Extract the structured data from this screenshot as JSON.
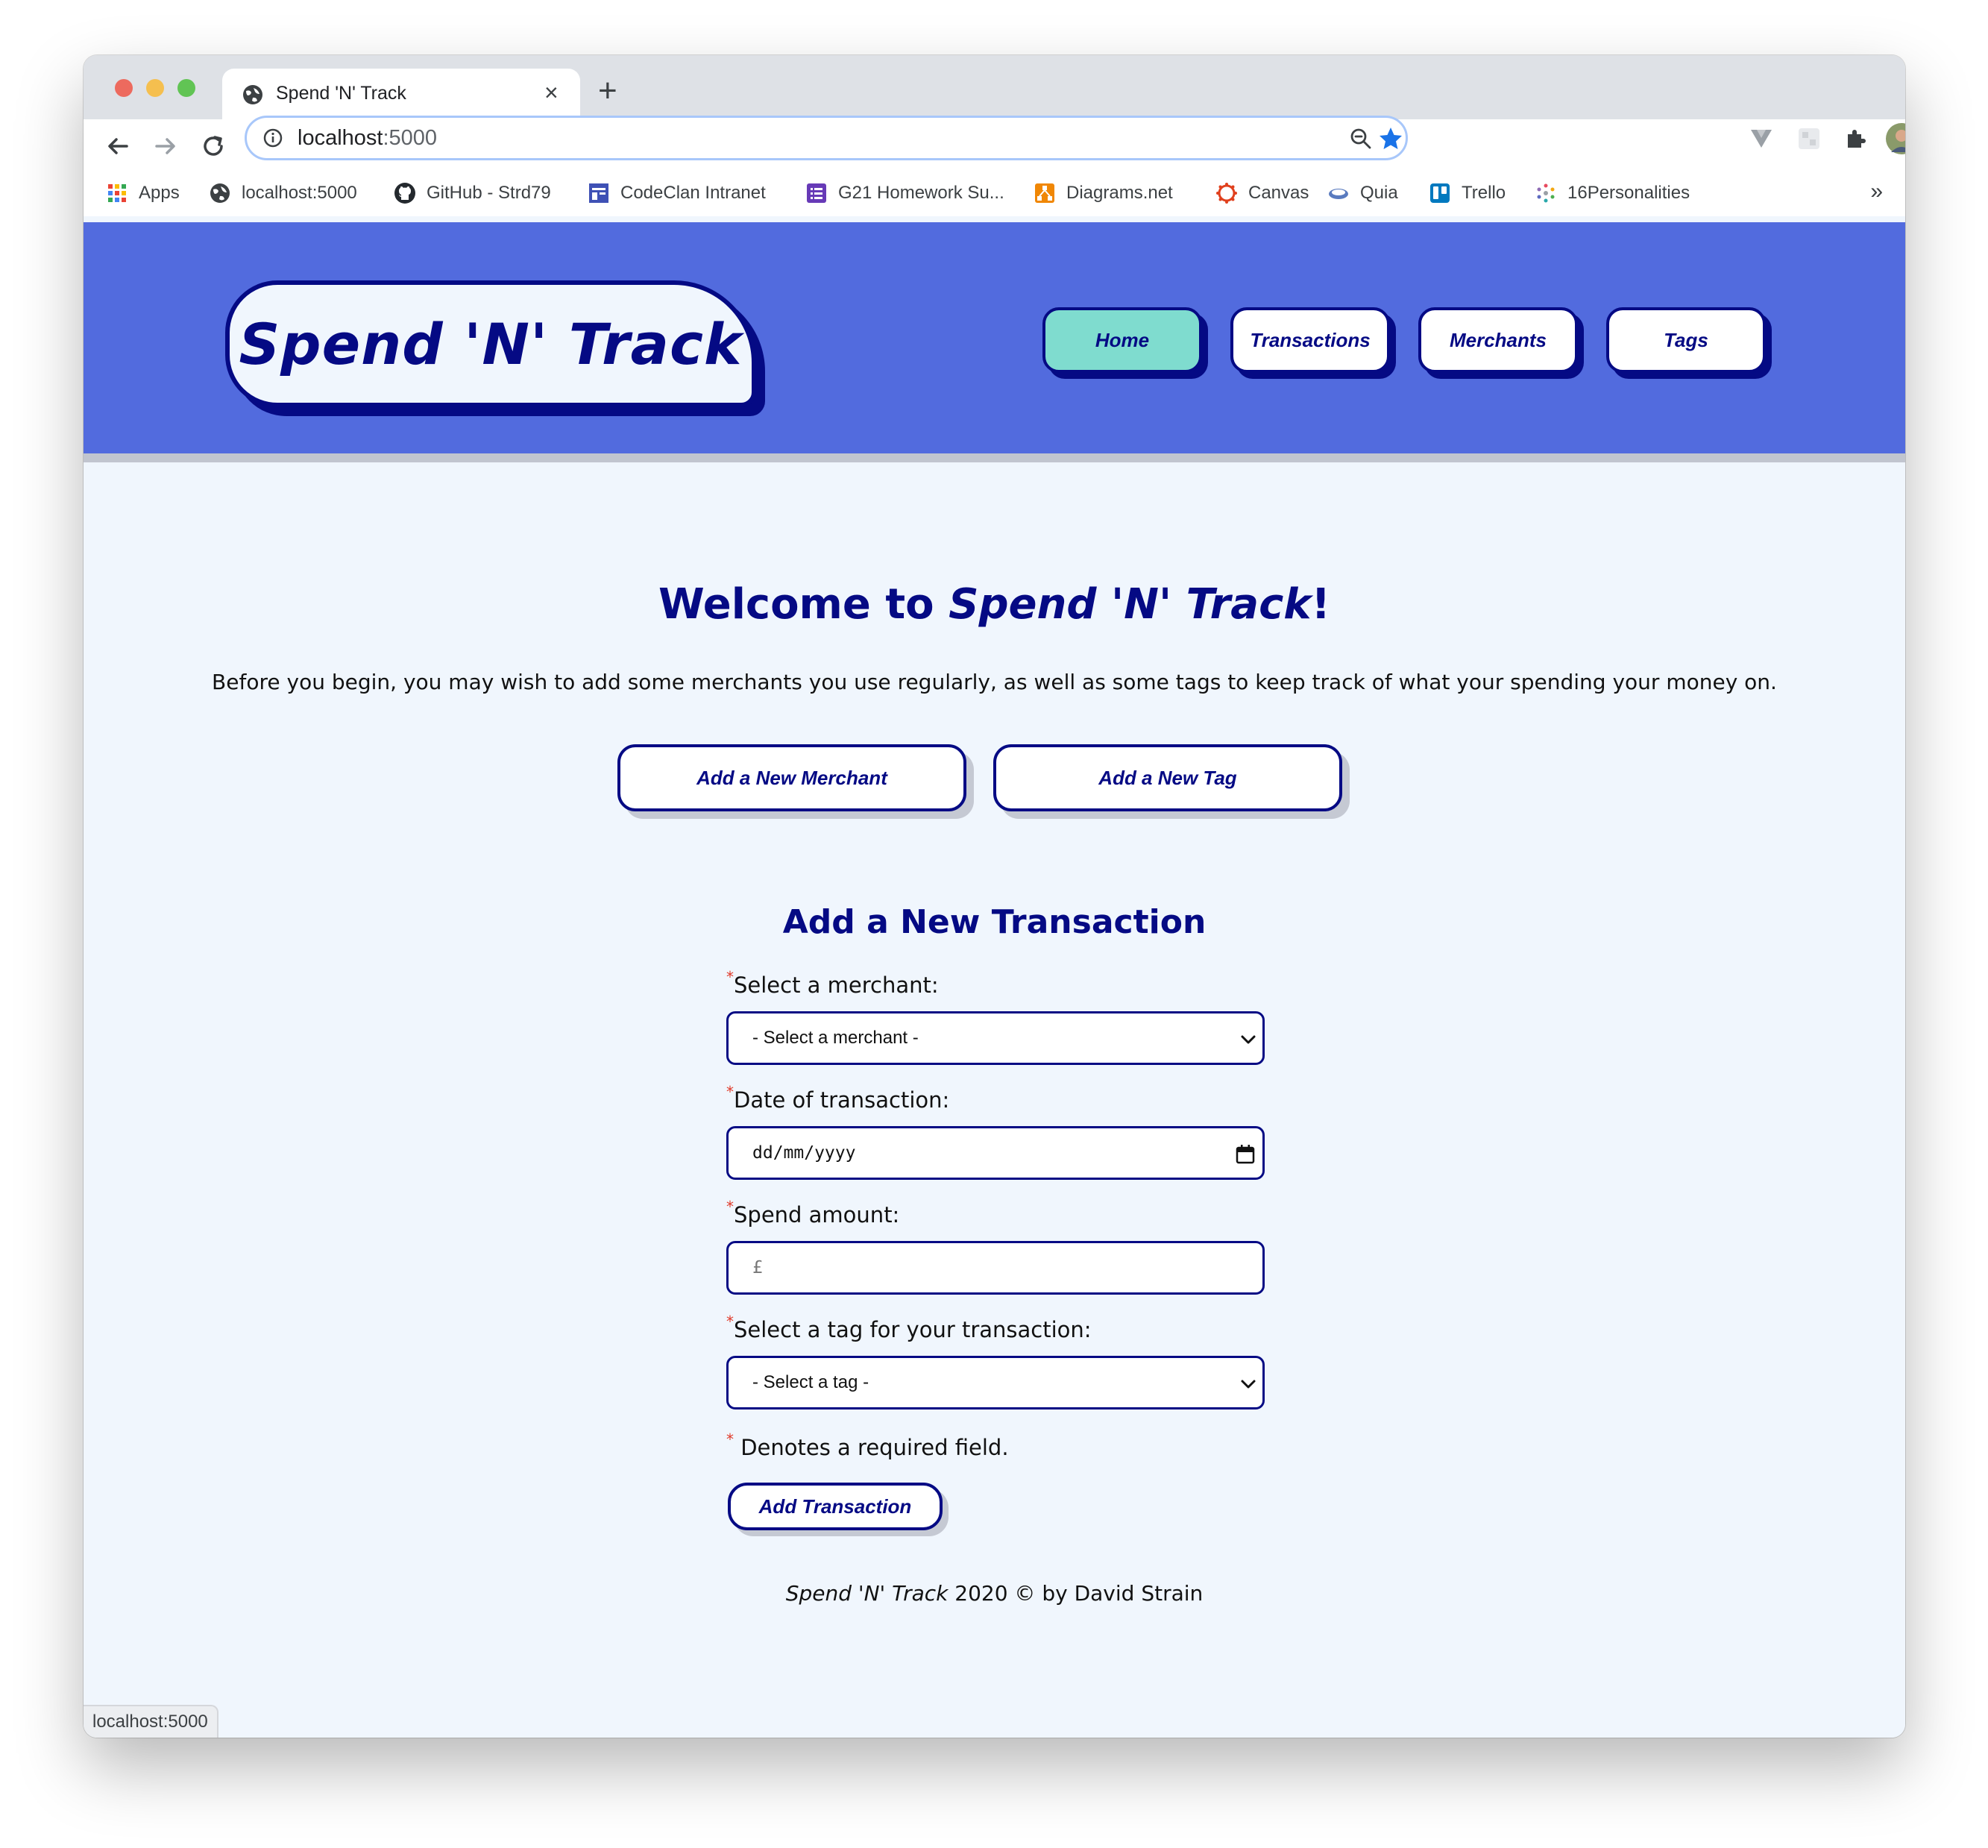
{
  "browser": {
    "tab_title": "Spend 'N' Track",
    "url_host": "localhost",
    "url_port": ":5000",
    "bookmarks": [
      {
        "label": "Apps",
        "icon": "apps-grid-icon"
      },
      {
        "label": "localhost:5000",
        "icon": "globe-icon"
      },
      {
        "label": "GitHub - Strd79",
        "icon": "github-icon"
      },
      {
        "label": "CodeClan Intranet",
        "icon": "intranet-icon"
      },
      {
        "label": "G21 Homework Su...",
        "icon": "list-icon"
      },
      {
        "label": "Diagrams.net",
        "icon": "diagrams-icon"
      },
      {
        "label": "Canvas",
        "icon": "canvas-icon"
      },
      {
        "label": "Quia",
        "icon": "quia-icon"
      },
      {
        "label": "Trello",
        "icon": "trello-icon"
      },
      {
        "label": "16Personalities",
        "icon": "personalities-icon"
      }
    ],
    "more_bookmarks": "»",
    "status_text": "localhost:5000"
  },
  "header": {
    "brand": "Spend 'N' Track",
    "nav": [
      {
        "label": "Home",
        "active": true
      },
      {
        "label": "Transactions",
        "active": false
      },
      {
        "label": "Merchants",
        "active": false
      },
      {
        "label": "Tags",
        "active": false
      }
    ]
  },
  "main": {
    "welcome_prefix": "Welcome to ",
    "welcome_brand": "Spend 'N' Track",
    "welcome_suffix": "!",
    "intro": "Before you begin, you may wish to add some merchants you use regularly, as well as some tags to keep track of what your spending your money on.",
    "add_merchant_label": "Add a New Merchant",
    "add_tag_label": "Add a New Tag"
  },
  "form": {
    "title": "Add a New Transaction",
    "required_mark": "*",
    "merchant_label": "Select a merchant:",
    "merchant_value": "- Select a merchant -",
    "date_label": "Date of transaction:",
    "date_placeholder": "dd/mm/yyyy",
    "amount_label": "Spend amount:",
    "amount_placeholder": "£",
    "tag_label": "Select a tag for your transaction:",
    "tag_value": "- Select a tag -",
    "required_note": " Denotes a required field.",
    "submit_label": "Add Transaction"
  },
  "footer": {
    "brand": "Spend 'N' Track",
    "text": " 2020 © by David Strain"
  },
  "colors": {
    "header_bg": "#526bde",
    "navy": "#050a84",
    "active_nav": "#7fdccf",
    "page_bg": "#f0f6fd",
    "required": "#e03a2a"
  }
}
